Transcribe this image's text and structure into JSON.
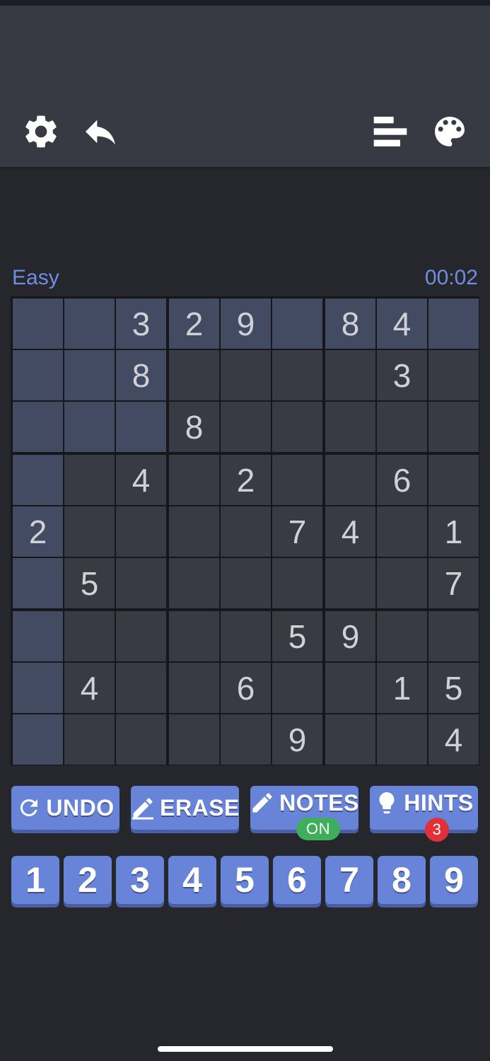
{
  "header": {
    "icons": [
      "gear-icon",
      "reply-arrow-icon",
      "stats-bars-icon",
      "palette-icon"
    ]
  },
  "game": {
    "difficulty": "Easy",
    "timer": "00:02"
  },
  "board": {
    "grid": [
      [
        "",
        "",
        "3",
        "2",
        "9",
        "",
        "8",
        "4",
        ""
      ],
      [
        "",
        "",
        "8",
        "",
        "",
        "",
        "",
        "3",
        ""
      ],
      [
        "",
        "",
        "",
        "8",
        "",
        "",
        "",
        "",
        ""
      ],
      [
        "",
        "",
        "4",
        "",
        "2",
        "",
        "",
        "6",
        ""
      ],
      [
        "2",
        "",
        "",
        "",
        "",
        "7",
        "4",
        "",
        "1"
      ],
      [
        "",
        "5",
        "",
        "",
        "",
        "",
        "",
        "",
        "7"
      ],
      [
        "",
        "",
        "",
        "",
        "",
        "5",
        "9",
        "",
        ""
      ],
      [
        "",
        "4",
        "",
        "",
        "6",
        "",
        "",
        "1",
        "5"
      ],
      [
        "",
        "",
        "",
        "",
        "",
        "9",
        "",
        "",
        "4"
      ]
    ],
    "selected_cell": {
      "row": 1,
      "col": 1
    },
    "colors": {
      "cell": "#383b43",
      "highlight": "#434b62",
      "digit": "#cfd1d6"
    }
  },
  "actions": {
    "undo": "UNDO",
    "erase": "ERASE",
    "notes": "NOTES",
    "notes_state": "ON",
    "hints": "HINTS",
    "hints_count": "3"
  },
  "numpad": [
    "1",
    "2",
    "3",
    "4",
    "5",
    "6",
    "7",
    "8",
    "9"
  ],
  "colors": {
    "accent": "#6784d9",
    "accent_text": "#6f8ee0",
    "on_badge": "#3fae5a",
    "hint_badge": "#e0313b"
  }
}
